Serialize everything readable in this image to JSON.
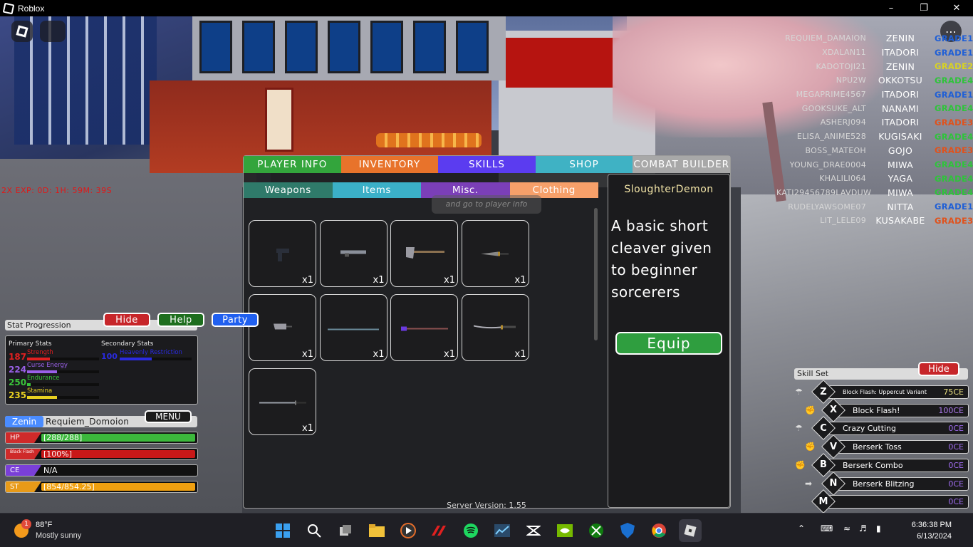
{
  "window": {
    "title": "Roblox"
  },
  "hud": {
    "exp_boost": "2X EXP: 0D: 1H: 59M: 39S"
  },
  "players": [
    {
      "name": "REQUIEM_DAMAION",
      "clan": "ZENIN",
      "grade": "GRADE1",
      "color": "#1f5fd6"
    },
    {
      "name": "XDALAN11",
      "clan": "ITADORI",
      "grade": "GRADE1",
      "color": "#1f5fd6"
    },
    {
      "name": "KADOTOJI21",
      "clan": "ZENIN",
      "grade": "GRADE2",
      "color": "#d8d223"
    },
    {
      "name": "NPU2W",
      "clan": "OKKOTSU",
      "grade": "GRADE4",
      "color": "#2ec43a"
    },
    {
      "name": "MEGAPRIME4567",
      "clan": "ITADORI",
      "grade": "GRADE1",
      "color": "#1f5fd6"
    },
    {
      "name": "GOOKSUKE_ALT",
      "clan": "NANAMI",
      "grade": "GRADE4",
      "color": "#2ec43a"
    },
    {
      "name": "ASHERJ094",
      "clan": "ITADORI",
      "grade": "GRADE3",
      "color": "#e0521c"
    },
    {
      "name": "ELISA_ANIME528",
      "clan": "KUGISAKI",
      "grade": "GRADE4",
      "color": "#2ec43a"
    },
    {
      "name": "BOSS_MATEOH",
      "clan": "GOJO",
      "grade": "GRADE3",
      "color": "#e0521c"
    },
    {
      "name": "YOUNG_DRAE0004",
      "clan": "MIWA",
      "grade": "GRADE4",
      "color": "#2ec43a"
    },
    {
      "name": "KHALILI064",
      "clan": "YAGA",
      "grade": "GRADE4",
      "color": "#2ec43a"
    },
    {
      "name": "KATI29456789LAVDUW",
      "clan": "MIWA",
      "grade": "GRADE4",
      "color": "#2ec43a"
    },
    {
      "name": "RUDELYAWSOME07",
      "clan": "NITTA",
      "grade": "GRADE1",
      "color": "#1f5fd6"
    },
    {
      "name": "LIT_LELE09",
      "clan": "KUSAKABE",
      "grade": "GRADE3",
      "color": "#e0521c"
    }
  ],
  "main_tabs": [
    {
      "label": "PLAYER INFO",
      "color": "#33a53c"
    },
    {
      "label": "INVENTORY",
      "color": "#e8732b"
    },
    {
      "label": "SKILLS",
      "color": "#5b3cf0"
    },
    {
      "label": "SHOP",
      "color": "#3fb2c4"
    },
    {
      "label": "COMBAT BUILDER",
      "color": "#a8a8a8"
    }
  ],
  "sub_tabs": [
    {
      "label": "Weapons",
      "color": "#2f7a6a"
    },
    {
      "label": "Items",
      "color": "#3bb0c8"
    },
    {
      "label": "Misc.",
      "color": "#7b3fb8"
    },
    {
      "label": "Clothing",
      "color": "#f7a06a"
    }
  ],
  "hint": "and go to player info",
  "inventory": [
    {
      "icon": "pistol-icon",
      "qty": "x1"
    },
    {
      "icon": "rifle-icon",
      "qty": "x1"
    },
    {
      "icon": "axe-icon",
      "qty": "x1"
    },
    {
      "icon": "dagger-icon",
      "qty": "x1"
    },
    {
      "icon": "cleaver-icon",
      "qty": "x1"
    },
    {
      "icon": "spear-icon",
      "qty": "x1"
    },
    {
      "icon": "staff-icon",
      "qty": "x1"
    },
    {
      "icon": "katana-icon",
      "qty": "x1"
    },
    {
      "icon": "sword-icon",
      "qty": "x1"
    }
  ],
  "detail": {
    "name": "SloughterDemon",
    "description": "A basic short cleaver given to beginner sorcerers",
    "equip_label": "Equip"
  },
  "server_version": "Server Version: 1.55",
  "stat_progression": {
    "title": "Stat Progression",
    "hide_label": "Hide",
    "help_label": "Help",
    "party_label": "Party",
    "primary_label": "Primary Stats",
    "secondary_label": "Secondary Stats",
    "primary": [
      {
        "value": "187",
        "name": "Strength",
        "color": "#e02020",
        "fill": 0.32
      },
      {
        "value": "224",
        "name": "Curse Energy",
        "color": "#9a60e8",
        "fill": 0.42
      },
      {
        "value": "250",
        "name": "Endurance",
        "color": "#3ac43a",
        "fill": 0.05
      },
      {
        "value": "235",
        "name": "Stamina",
        "color": "#e8d020",
        "fill": 0.42
      }
    ],
    "secondary": [
      {
        "value": "100",
        "name": "Heavenly Restriction",
        "color": "#2a2ae0",
        "fill": 0.45
      }
    ]
  },
  "player": {
    "clan": "Zenin",
    "name": "Requiem_Domoion",
    "menu_label": "MENU",
    "bars": [
      {
        "tag": "HP",
        "text": "[288/288]",
        "color": "#cf2a2a",
        "fill_color": "#3cb83c",
        "fill": 1.0
      },
      {
        "tag": "Black Flash",
        "text": "[100%]",
        "color": "#cf2a2a",
        "fill_color": "#c81818",
        "fill": 1.0
      },
      {
        "tag": "CE",
        "text": "N/A",
        "color": "#7a3fd8",
        "fill_color": "#111111",
        "fill": 0.0
      },
      {
        "tag": "ST",
        "text": "[854/854.25]",
        "color": "#e89a18",
        "fill_color": "#f0a010",
        "fill": 1.0
      }
    ]
  },
  "skill_set": {
    "title": "Skill Set",
    "hide_label": "Hide",
    "skills": [
      {
        "key": "Z",
        "name": "Block Flash: Uppercut Variant",
        "cost": "75CE",
        "cost_color": "#e8e080",
        "icon": "umbrella-icon"
      },
      {
        "key": "X",
        "name": "Block Flash!",
        "cost": "100CE",
        "cost_color": "#b07cf0",
        "icon": "fist-icon"
      },
      {
        "key": "C",
        "name": "Crazy Cutting",
        "cost": "0CE",
        "cost_color": "#a06cf0",
        "icon": "umbrella-icon"
      },
      {
        "key": "V",
        "name": "Berserk Toss",
        "cost": "0CE",
        "cost_color": "#a06cf0",
        "icon": "fist-icon"
      },
      {
        "key": "B",
        "name": "Berserk Combo",
        "cost": "0CE",
        "cost_color": "#a06cf0",
        "icon": "fist-icon"
      },
      {
        "key": "N",
        "name": "Berserk Blitzing",
        "cost": "0CE",
        "cost_color": "#a06cf0",
        "icon": "dash-icon"
      },
      {
        "key": "M",
        "name": "",
        "cost": "0CE",
        "cost_color": "#a06cf0",
        "icon": ""
      }
    ]
  },
  "taskbar": {
    "weather_temp": "88°F",
    "weather_desc": "Mostly sunny",
    "weather_badge": "1",
    "time": "6:36:38 PM",
    "date": "6/13/2024",
    "apps": [
      "windows-start-icon",
      "search-icon",
      "task-view-icon",
      "file-explorer-icon",
      "media-player-icon",
      "armoury-crate-icon",
      "spotify-icon",
      "stocks-icon",
      "capcut-icon",
      "nvidia-icon",
      "xbox-icon",
      "defender-icon",
      "chrome-icon",
      "roblox-icon"
    ]
  }
}
